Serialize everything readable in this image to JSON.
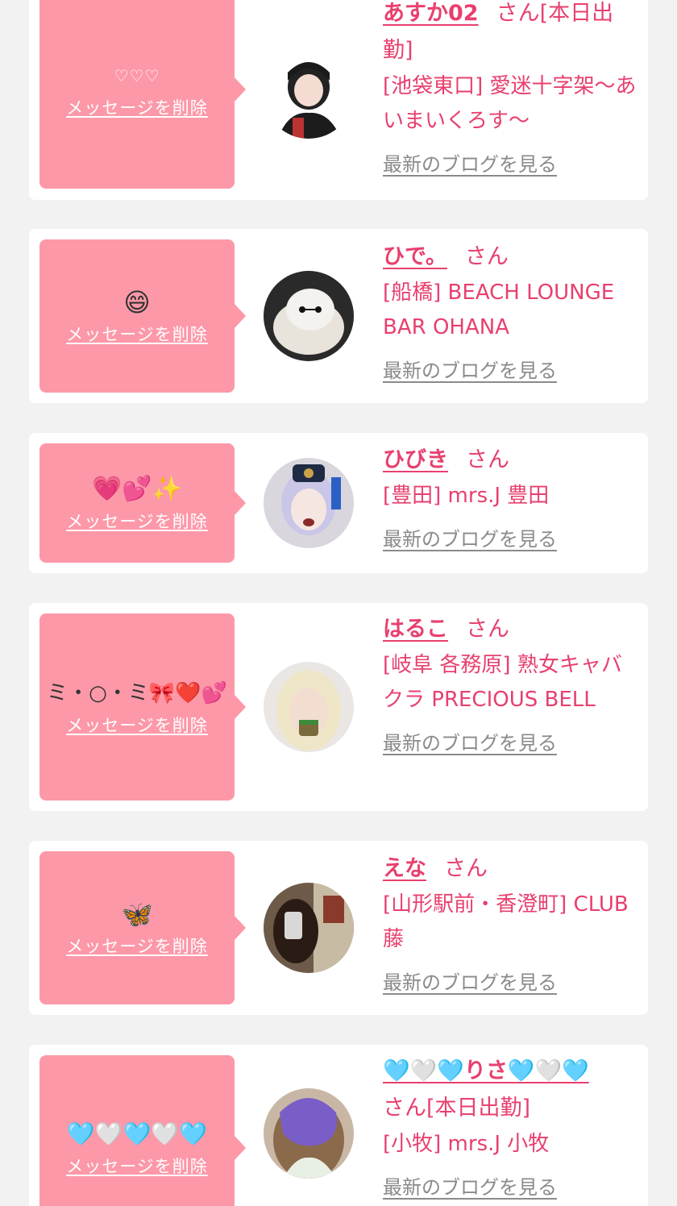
{
  "cards": [
    {
      "emoji": "♡♡♡",
      "delete_label": "メッセージを削除",
      "name": "あすか02",
      "name_suffix": "さん[本日出勤]",
      "shop": "[池袋東口] 愛迷十字架〜あいまいくろす〜",
      "blog_label": "最新のブログを見る"
    },
    {
      "emoji": "😄",
      "delete_label": "メッセージを削除",
      "name": "ひで。",
      "name_suffix": "さん",
      "shop": "[船橋] BEACH LOUNGE BAR OHANA",
      "blog_label": "最新のブログを見る"
    },
    {
      "emoji": "💗💕✨",
      "delete_label": "メッセージを削除",
      "name": "ひびき",
      "name_suffix": "さん",
      "shop": "[豊田] mrs.J 豊田",
      "blog_label": "最新のブログを見る"
    },
    {
      "emoji": "ミ・○・ミ🎀❤️💕",
      "delete_label": "メッセージを削除",
      "name": "はるこ",
      "name_suffix": "さん",
      "shop": "[岐阜 各務原]  熟女キャバクラ PRECIOUS BELL",
      "blog_label": "最新のブログを見る"
    },
    {
      "emoji": "🦋",
      "delete_label": "メッセージを削除",
      "name": "えな",
      "name_suffix": "さん",
      "shop": "[山形駅前・香澄町] CLUB 藤",
      "blog_label": "最新のブログを見る"
    },
    {
      "emoji": "🩵🤍🩵🤍🩵",
      "delete_label": "メッセージを削除",
      "name": "🩵🤍🩵りさ🩵🤍🩵",
      "name_suffix": "さん[本日出勤]",
      "shop": "[小牧] mrs.J 小牧",
      "blog_label": "最新のブログを見る"
    }
  ],
  "colors": {
    "background": "#f2f2f2",
    "card": "#ffffff",
    "bubble": "#fd98a8",
    "accent": "#e8406e",
    "link_gray": "#8a8a8a"
  }
}
